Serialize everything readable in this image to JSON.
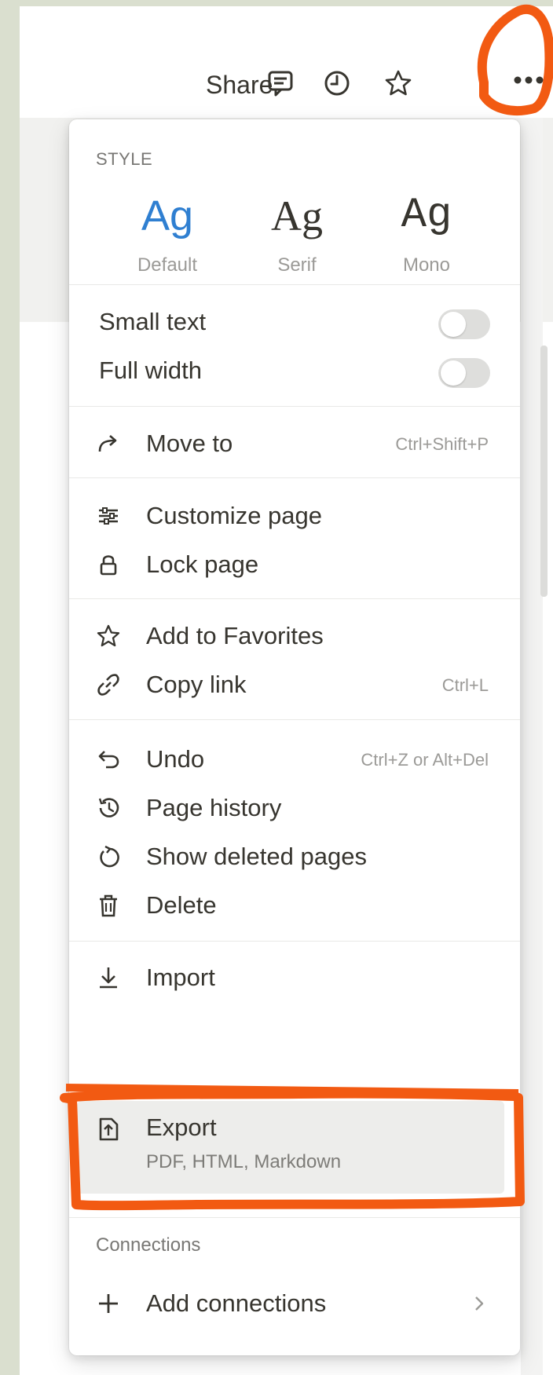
{
  "topbar": {
    "share_label": "Share",
    "icons": [
      "comment-icon",
      "clock-icon",
      "star-icon",
      "more-dots-icon"
    ]
  },
  "menu": {
    "style_section": {
      "label": "STYLE",
      "options": [
        {
          "sample": "Ag",
          "caption": "Default"
        },
        {
          "sample": "Ag",
          "caption": "Serif"
        },
        {
          "sample": "Ag",
          "caption": "Mono"
        }
      ]
    },
    "toggles": [
      {
        "label": "Small text",
        "on": false
      },
      {
        "label": "Full width",
        "on": false
      }
    ],
    "move_to": {
      "label": "Move to",
      "shortcut": "Ctrl+Shift+P",
      "icon": "arrow-turn-right-icon"
    },
    "customize_page": {
      "label": "Customize page",
      "icon": "sliders-icon"
    },
    "lock_page": {
      "label": "Lock page",
      "icon": "lock-icon"
    },
    "add_favorites": {
      "label": "Add to Favorites",
      "icon": "star-icon"
    },
    "copy_link": {
      "label": "Copy link",
      "shortcut": "Ctrl+L",
      "icon": "link-icon"
    },
    "undo": {
      "label": "Undo",
      "shortcut": "Ctrl+Z or Alt+Del",
      "icon": "undo-icon"
    },
    "page_history": {
      "label": "Page history",
      "icon": "history-icon"
    },
    "show_deleted": {
      "label": "Show deleted pages",
      "icon": "restore-icon"
    },
    "delete": {
      "label": "Delete",
      "icon": "trash-icon"
    },
    "import": {
      "label": "Import",
      "icon": "download-icon"
    },
    "export": {
      "label": "Export",
      "sublabel": "PDF, HTML, Markdown",
      "icon": "export-file-icon"
    },
    "connections": {
      "label": "Connections"
    },
    "add_connections": {
      "label": "Add connections",
      "icon": "plus-icon"
    }
  },
  "colors": {
    "annotation": "#f25a12",
    "accent_blue": "#2f7fd1",
    "text": "#37352f",
    "muted": "#9b9a97"
  }
}
